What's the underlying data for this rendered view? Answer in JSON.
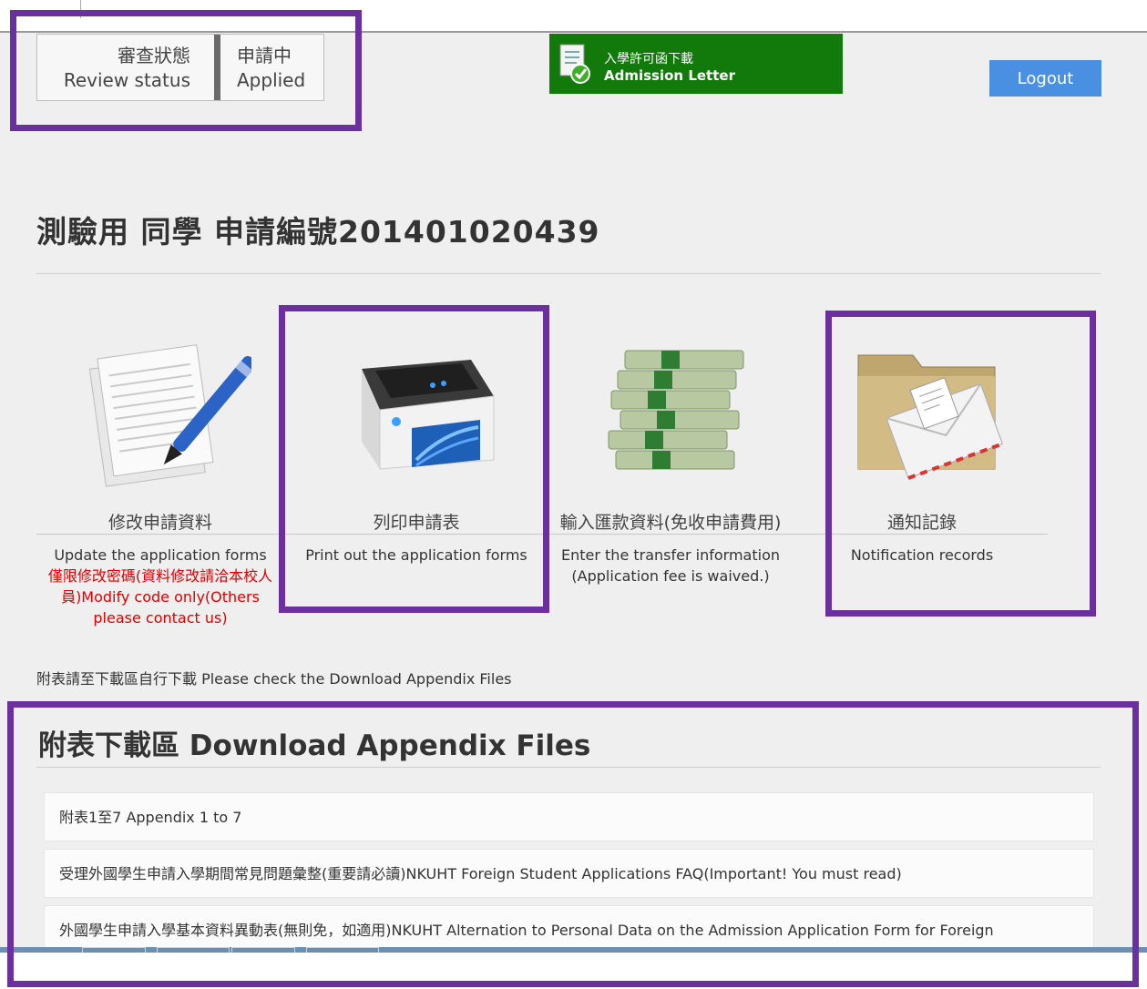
{
  "review_status": {
    "label_zh": "審查狀態",
    "label_en": "Review status",
    "value_zh": "申請中",
    "value_en": "Applied"
  },
  "admission_letter": {
    "zh": "入學許可函下載",
    "en": "Admission Letter",
    "icon": "document-check-icon"
  },
  "logout_label": "Logout",
  "page_heading": "測驗用 同學 申請編號201401020439",
  "actions": [
    {
      "zh": "修改申請資料",
      "en": "Update the application forms",
      "note": "僅限修改密碼(資料修改請洽本校人員)Modify code only(Others please contact us)",
      "icon": "document-pen-icon"
    },
    {
      "zh": "列印申請表",
      "en": "Print out the application forms",
      "icon": "printer-icon"
    },
    {
      "zh": "輸入匯款資料(免收申請費用)",
      "en": "Enter the transfer information (Application fee is waived.)",
      "icon": "money-stack-icon"
    },
    {
      "zh": "通知記錄",
      "en": "Notification records",
      "icon": "folder-mail-icon"
    }
  ],
  "appendix_note": "附表請至下載區自行下載 Please check the Download Appendix Files",
  "download_heading": "附表下載區 Download Appendix Files",
  "downloads": [
    "附表1至7 Appendix 1 to 7",
    "受理外國學生申請入學期間常見問題彙整(重要請必讀)NKUHT Foreign Student Applications FAQ(Important! You must read)",
    "外國學生申請入學基本資料異動表(無則免，如適用)NKUHT Alternation to Personal Data on the Admission Application Form for Foreign"
  ],
  "colors": {
    "admission_bg": "#117a0b",
    "logout_bg": "#4a90e2",
    "highlight": "#6c2fa0",
    "warning_text": "#e00000"
  }
}
